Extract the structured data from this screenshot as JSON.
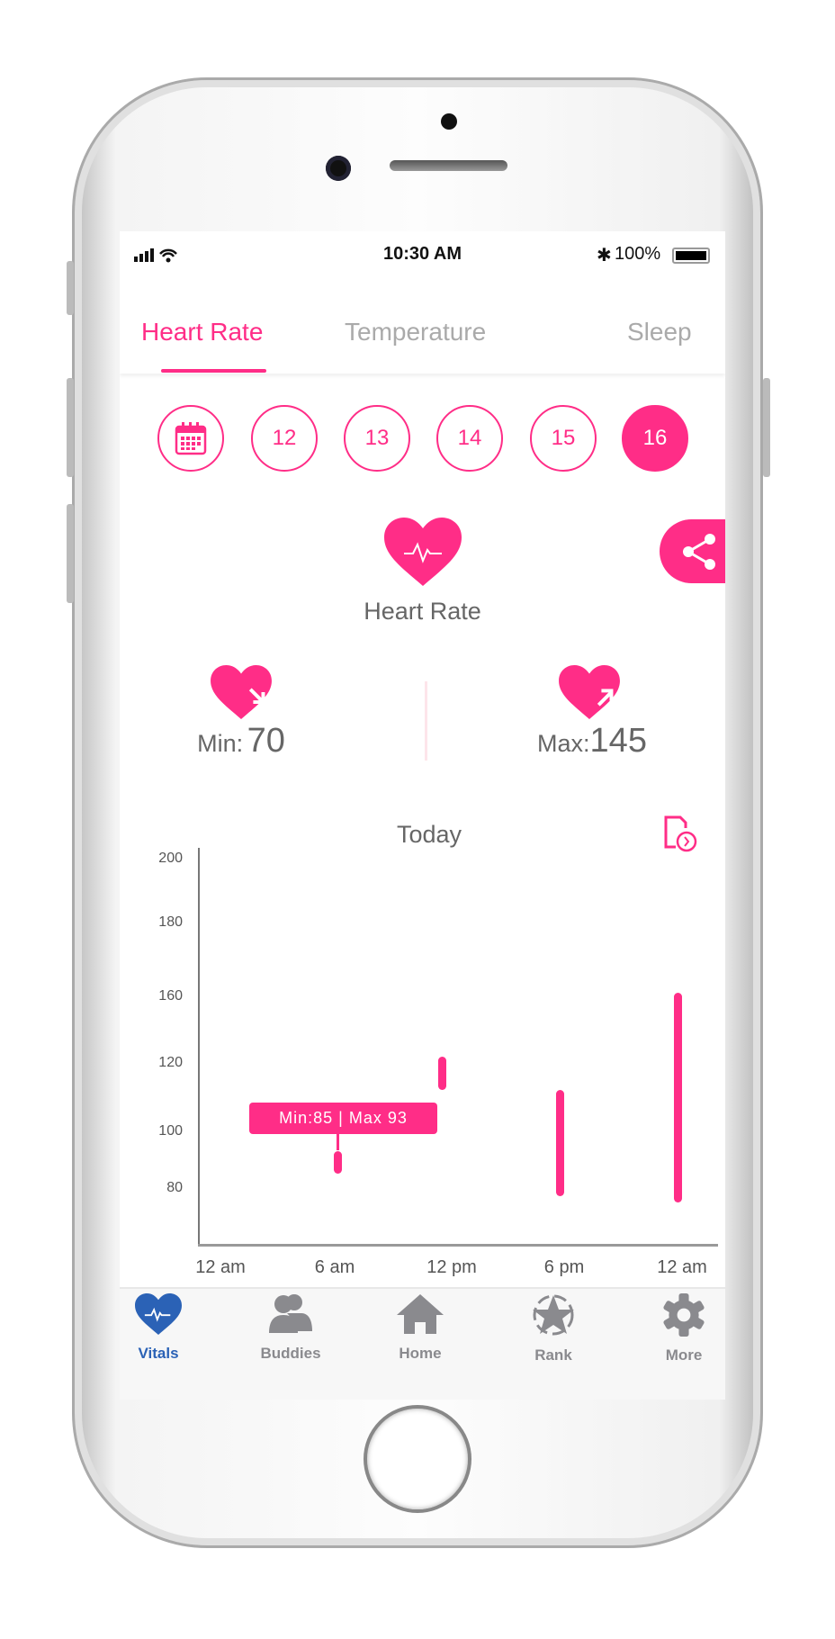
{
  "status": {
    "time": "10:30 AM",
    "battery": "100%"
  },
  "tabs": [
    {
      "label": "Heart Rate",
      "active": true
    },
    {
      "label": "Temperature"
    },
    {
      "label": "Sleep"
    }
  ],
  "dates": [
    "12",
    "13",
    "14",
    "15",
    "16"
  ],
  "selected_date": "16",
  "metric": {
    "title": "Heart Rate",
    "min_label": "Min:",
    "min_value": "70",
    "max_label": "Max:",
    "max_value": "145"
  },
  "accent": "#ff2d87",
  "chart_data": {
    "type": "range-bar",
    "title": "Today",
    "y_ticks": [
      200,
      180,
      160,
      120,
      100,
      80
    ],
    "x_ticks": [
      "12 am",
      "6 am",
      "12 pm",
      "6 pm",
      "12 am"
    ],
    "ranges": [
      {
        "x": "6 am",
        "min": 85,
        "max": 93
      },
      {
        "x": "12 pm",
        "min": 112,
        "max": 124
      },
      {
        "x": "6 pm",
        "min": 77,
        "max": 112
      },
      {
        "x": "12 am",
        "min": 75,
        "max": 161
      }
    ],
    "tooltip": "Min:85 | Max 93"
  },
  "nav": [
    {
      "label": "Vitals",
      "icon": "heart-pulse-icon",
      "active": true
    },
    {
      "label": "Buddies",
      "icon": "people-icon"
    },
    {
      "label": "Home",
      "icon": "home-icon"
    },
    {
      "label": "Rank",
      "icon": "star-badge-icon"
    },
    {
      "label": "More",
      "icon": "gear-icon"
    }
  ],
  "nav_active_color": "#2b62b6"
}
